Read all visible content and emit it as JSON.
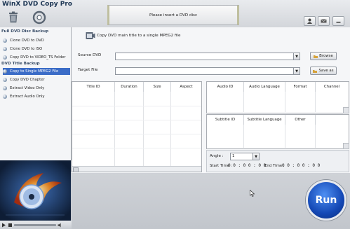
{
  "app": {
    "title": "WinX DVD Copy Pro"
  },
  "status": {
    "message": "Please insert a DVD disc"
  },
  "sidebar": {
    "sections": [
      {
        "title": "Full DVD Disc Backup",
        "items": [
          "Clone DVD to DVD",
          "Clone DVD to ISO",
          "Copy DVD to VIDEO_TS Folder"
        ]
      },
      {
        "title": "DVD Title Backup",
        "items": [
          "Copy to Single MPEG2 File",
          "Copy DVD Chapter",
          "Extract Video Only",
          "Extract Audio Only"
        ]
      }
    ],
    "selected": "Copy to Single MPEG2 File"
  },
  "main": {
    "description": "Copy DVD main title to a single MPEG2 file",
    "source_label": "Source DVD",
    "target_label": "Target File",
    "source_value": "",
    "target_value": "",
    "browse_label": "Browse",
    "saveas_label": "Save as"
  },
  "title_table": {
    "headers": [
      "Title ID",
      "Duration",
      "Size",
      "Aspect"
    ]
  },
  "audio_table": {
    "headers": [
      "Audio ID",
      "Audio Language",
      "Format",
      "Channel"
    ]
  },
  "subtitle_table": {
    "headers": [
      "Subtitle ID",
      "Subtitle Language",
      "Other"
    ]
  },
  "angle": {
    "label": "Angle :",
    "value": "1"
  },
  "times": {
    "start_label": "Start Time :",
    "start_value": "0 0 : 0 0 : 0 0",
    "end_label": "End Time :",
    "end_value": "0 0 : 0 0 : 0 0"
  },
  "run_label": "Run"
}
